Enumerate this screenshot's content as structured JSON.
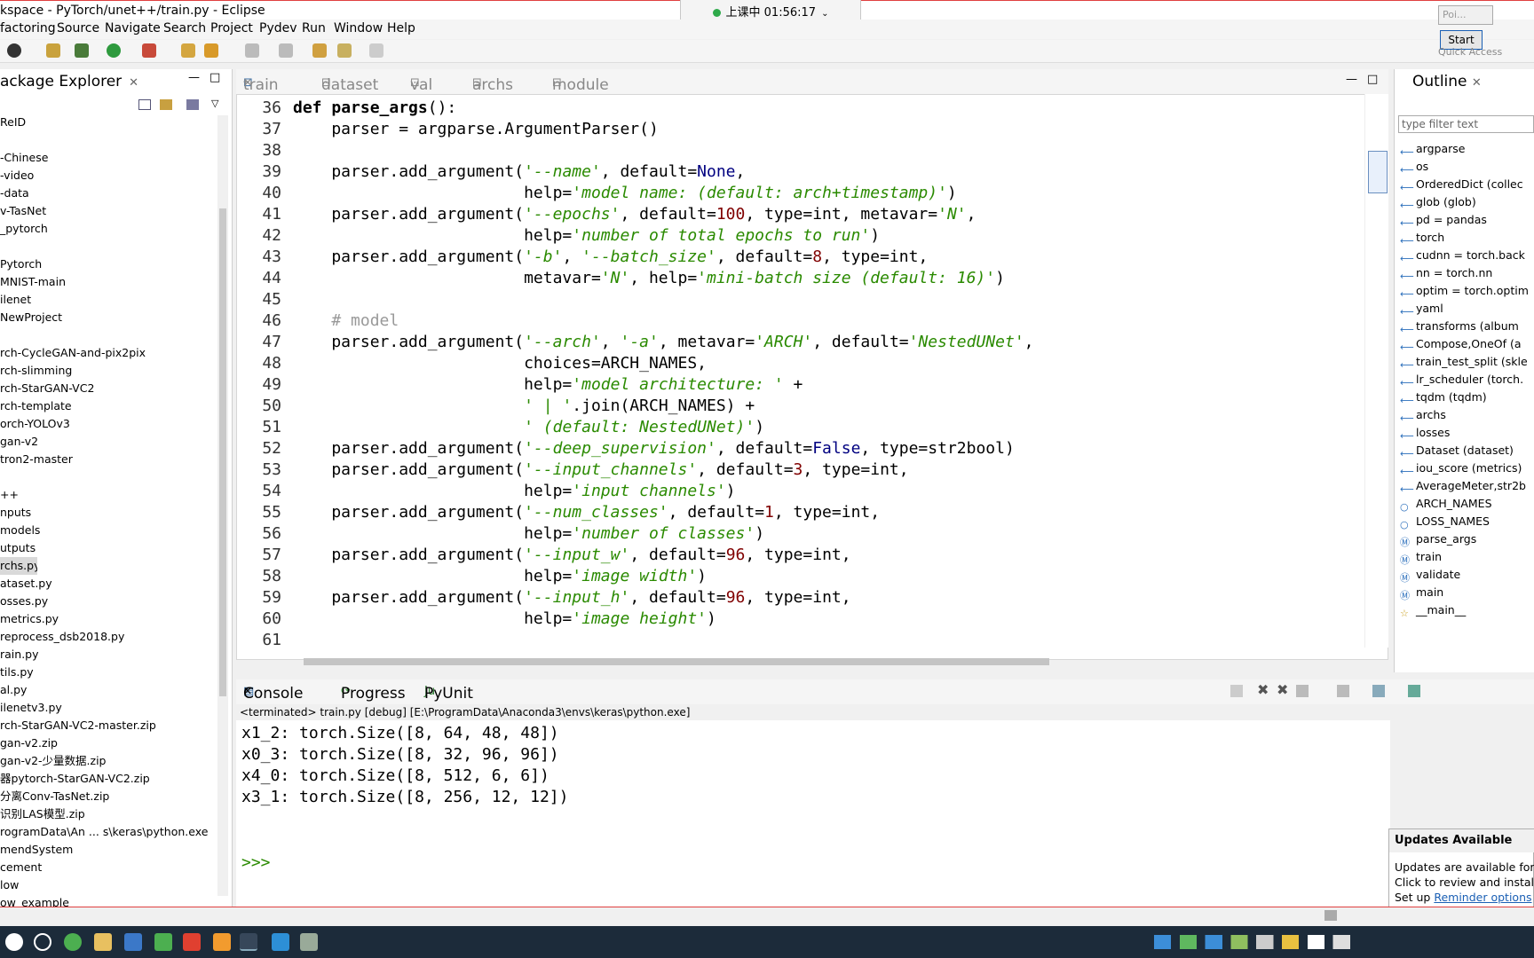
{
  "window": {
    "title": "kspace - PyTorch/unet++/train.py - Eclipse"
  },
  "class_status": "上课中 01:56:17",
  "menu": [
    "factoring",
    "Source",
    "Navigate",
    "Search",
    "Project",
    "Pydev",
    "Run",
    "Window",
    "Help"
  ],
  "popup": {
    "label": "Poi...",
    "start": "Start",
    "quick_access": "Quick Access"
  },
  "package_explorer": {
    "title": "ackage Explorer",
    "items": [
      "ReID",
      "",
      "-Chinese",
      "-video",
      "-data",
      "v-TasNet",
      "_pytorch",
      "",
      "Pytorch",
      "MNIST-main",
      "ilenet",
      "NewProject",
      "",
      "rch-CycleGAN-and-pix2pix",
      "rch-slimming",
      "rch-StarGAN-VC2",
      "rch-template",
      "orch-YOLOv3",
      "gan-v2",
      "tron2-master",
      "",
      "++",
      "nputs",
      "models",
      "utputs",
      "rchs.py",
      "ataset.py",
      "osses.py",
      "metrics.py",
      "reprocess_dsb2018.py",
      "rain.py",
      "tils.py",
      "al.py",
      "ilenetv3.py",
      "rch-StarGAN-VC2-master.zip",
      "gan-v2.zip",
      "gan-v2-少量数据.zip",
      "器pytorch-StarGAN-VC2.zip",
      "分离Conv-TasNet.zip",
      "识别LAS模型.zip",
      "rogramData\\An ... s\\keras\\python.exe",
      "mendSystem",
      "cement",
      "low",
      "ow_example"
    ]
  },
  "editor": {
    "tabs": [
      "train",
      "dataset",
      "val",
      "archs",
      "module"
    ],
    "lines": [
      {
        "n": "36",
        "parts": [
          [
            "kw",
            "def "
          ],
          [
            "kw",
            "parse_args"
          ],
          [
            "",
            "():"
          ]
        ]
      },
      {
        "n": "37",
        "parts": [
          [
            "",
            "    parser = argparse.ArgumentParser()"
          ]
        ]
      },
      {
        "n": "38",
        "parts": [
          [
            "",
            ""
          ]
        ]
      },
      {
        "n": "39",
        "parts": [
          [
            "",
            "    parser.add_argument("
          ],
          [
            "str",
            "'--name'"
          ],
          [
            "",
            ", default="
          ],
          [
            "bi",
            "None"
          ],
          [
            "",
            ","
          ]
        ]
      },
      {
        "n": "40",
        "parts": [
          [
            "",
            "                        help="
          ],
          [
            "str",
            "'model name: (default: arch+timestamp)'"
          ],
          [
            "",
            ")"
          ]
        ]
      },
      {
        "n": "41",
        "parts": [
          [
            "",
            "    parser.add_argument("
          ],
          [
            "str",
            "'--epochs'"
          ],
          [
            "",
            ", default="
          ],
          [
            "num",
            "100"
          ],
          [
            "",
            ", type=int, metavar="
          ],
          [
            "str",
            "'N'"
          ],
          [
            "",
            ","
          ]
        ]
      },
      {
        "n": "42",
        "parts": [
          [
            "",
            "                        help="
          ],
          [
            "str",
            "'number of total epochs to run'"
          ],
          [
            "",
            ")"
          ]
        ]
      },
      {
        "n": "43",
        "parts": [
          [
            "",
            "    parser.add_argument("
          ],
          [
            "str",
            "'-b'"
          ],
          [
            "",
            ", "
          ],
          [
            "str",
            "'--batch_size'"
          ],
          [
            "",
            ", default="
          ],
          [
            "num",
            "8"
          ],
          [
            "",
            ", type=int,"
          ]
        ]
      },
      {
        "n": "44",
        "parts": [
          [
            "",
            "                        metavar="
          ],
          [
            "str",
            "'N'"
          ],
          [
            "",
            ", help="
          ],
          [
            "str",
            "'mini-batch size (default: 16)'"
          ],
          [
            "",
            ")"
          ]
        ]
      },
      {
        "n": "45",
        "parts": [
          [
            "",
            ""
          ]
        ]
      },
      {
        "n": "46",
        "parts": [
          [
            "cm",
            "    # model"
          ]
        ]
      },
      {
        "n": "47",
        "parts": [
          [
            "",
            "    parser.add_argument("
          ],
          [
            "str",
            "'--arch'"
          ],
          [
            "",
            ", "
          ],
          [
            "str",
            "'-a'"
          ],
          [
            "",
            ", metavar="
          ],
          [
            "str",
            "'ARCH'"
          ],
          [
            "",
            ", default="
          ],
          [
            "str",
            "'NestedUNet'"
          ],
          [
            "",
            ","
          ]
        ]
      },
      {
        "n": "48",
        "parts": [
          [
            "",
            "                        choices=ARCH_NAMES,"
          ]
        ]
      },
      {
        "n": "49",
        "parts": [
          [
            "",
            "                        help="
          ],
          [
            "str",
            "'model architecture: '"
          ],
          [
            "",
            " +"
          ]
        ]
      },
      {
        "n": "50",
        "parts": [
          [
            "",
            "                        "
          ],
          [
            "str",
            "' | '"
          ],
          [
            "",
            ".join(ARCH_NAMES) +"
          ]
        ]
      },
      {
        "n": "51",
        "parts": [
          [
            "",
            "                        "
          ],
          [
            "str",
            "' (default: NestedUNet)'"
          ],
          [
            "",
            ")"
          ]
        ]
      },
      {
        "n": "52",
        "parts": [
          [
            "",
            "    parser.add_argument("
          ],
          [
            "str",
            "'--deep_supervision'"
          ],
          [
            "",
            ", default="
          ],
          [
            "bi",
            "False"
          ],
          [
            "",
            ", type=str2bool)"
          ]
        ]
      },
      {
        "n": "53",
        "parts": [
          [
            "",
            "    parser.add_argument("
          ],
          [
            "str",
            "'--input_channels'"
          ],
          [
            "",
            ", default="
          ],
          [
            "num",
            "3"
          ],
          [
            "",
            ", type=int,"
          ]
        ]
      },
      {
        "n": "54",
        "parts": [
          [
            "",
            "                        help="
          ],
          [
            "str",
            "'input channels'"
          ],
          [
            "",
            ")"
          ]
        ]
      },
      {
        "n": "55",
        "parts": [
          [
            "",
            "    parser.add_argument("
          ],
          [
            "str",
            "'--num_classes'"
          ],
          [
            "",
            ", default="
          ],
          [
            "num",
            "1"
          ],
          [
            "",
            ", type=int,"
          ]
        ]
      },
      {
        "n": "56",
        "parts": [
          [
            "",
            "                        help="
          ],
          [
            "str",
            "'number of classes'"
          ],
          [
            "",
            ")"
          ]
        ]
      },
      {
        "n": "57",
        "parts": [
          [
            "",
            "    parser.add_argument("
          ],
          [
            "str",
            "'--input_w'"
          ],
          [
            "",
            ", default="
          ],
          [
            "num",
            "96"
          ],
          [
            "",
            ", type=int,"
          ]
        ]
      },
      {
        "n": "58",
        "parts": [
          [
            "",
            "                        help="
          ],
          [
            "str",
            "'image width'"
          ],
          [
            "",
            ")"
          ]
        ]
      },
      {
        "n": "59",
        "parts": [
          [
            "",
            "    parser.add_argument("
          ],
          [
            "str",
            "'--input_h'"
          ],
          [
            "",
            ", default="
          ],
          [
            "num",
            "96"
          ],
          [
            "",
            ", type=int,"
          ]
        ]
      },
      {
        "n": "60",
        "parts": [
          [
            "",
            "                        help="
          ],
          [
            "str",
            "'image height'"
          ],
          [
            "",
            ")"
          ]
        ]
      },
      {
        "n": "61",
        "parts": [
          [
            "",
            ""
          ]
        ]
      }
    ]
  },
  "outline": {
    "title": "Outline",
    "filter_placeholder": "type filter text",
    "items": [
      {
        "label": "argparse",
        "icon": "import-icon"
      },
      {
        "label": "os",
        "icon": "import-icon"
      },
      {
        "label": "OrderedDict (collec",
        "icon": "import-icon"
      },
      {
        "label": "glob (glob)",
        "icon": "import-icon"
      },
      {
        "label": "pd = pandas",
        "icon": "import-icon"
      },
      {
        "label": "torch",
        "icon": "import-icon"
      },
      {
        "label": "cudnn = torch.back",
        "icon": "import-icon"
      },
      {
        "label": "nn = torch.nn",
        "icon": "import-icon"
      },
      {
        "label": "optim = torch.optim",
        "icon": "import-icon"
      },
      {
        "label": "yaml",
        "icon": "import-icon"
      },
      {
        "label": "transforms (album",
        "icon": "import-icon"
      },
      {
        "label": "Compose,OneOf (a",
        "icon": "import-icon"
      },
      {
        "label": "train_test_split (skle",
        "icon": "import-icon"
      },
      {
        "label": "lr_scheduler (torch.",
        "icon": "import-icon"
      },
      {
        "label": "tqdm (tqdm)",
        "icon": "import-icon"
      },
      {
        "label": "archs",
        "icon": "import-icon"
      },
      {
        "label": "losses",
        "icon": "import-icon"
      },
      {
        "label": "Dataset (dataset)",
        "icon": "import-icon"
      },
      {
        "label": "iou_score (metrics)",
        "icon": "import-icon"
      },
      {
        "label": "AverageMeter,str2b",
        "icon": "import-icon"
      },
      {
        "label": "ARCH_NAMES",
        "icon": "variable-icon"
      },
      {
        "label": "LOSS_NAMES",
        "icon": "variable-icon"
      },
      {
        "label": "parse_args",
        "icon": "function-icon"
      },
      {
        "label": "train",
        "icon": "function-icon"
      },
      {
        "label": "validate",
        "icon": "function-icon"
      },
      {
        "label": "main",
        "icon": "function-icon"
      },
      {
        "label": "__main__",
        "icon": "main-icon"
      }
    ]
  },
  "console": {
    "tabs": [
      "Console",
      "Progress",
      "PyUnit"
    ],
    "path": "<terminated> train.py [debug] [E:\\ProgramData\\Anaconda3\\envs\\keras\\python.exe]",
    "lines": [
      "x1_2: torch.Size([8, 64, 48, 48])",
      "x0_3: torch.Size([8, 32, 96, 96])",
      "x4_0: torch.Size([8, 512, 6, 6])",
      "x3_1: torch.Size([8, 256, 12, 12])"
    ],
    "prompt": ">>>"
  },
  "updates": {
    "title": "Updates Available",
    "line1": "Updates are available for y",
    "line2": "Click to review and install u",
    "line3": "Set up",
    "link": "Reminder options"
  }
}
